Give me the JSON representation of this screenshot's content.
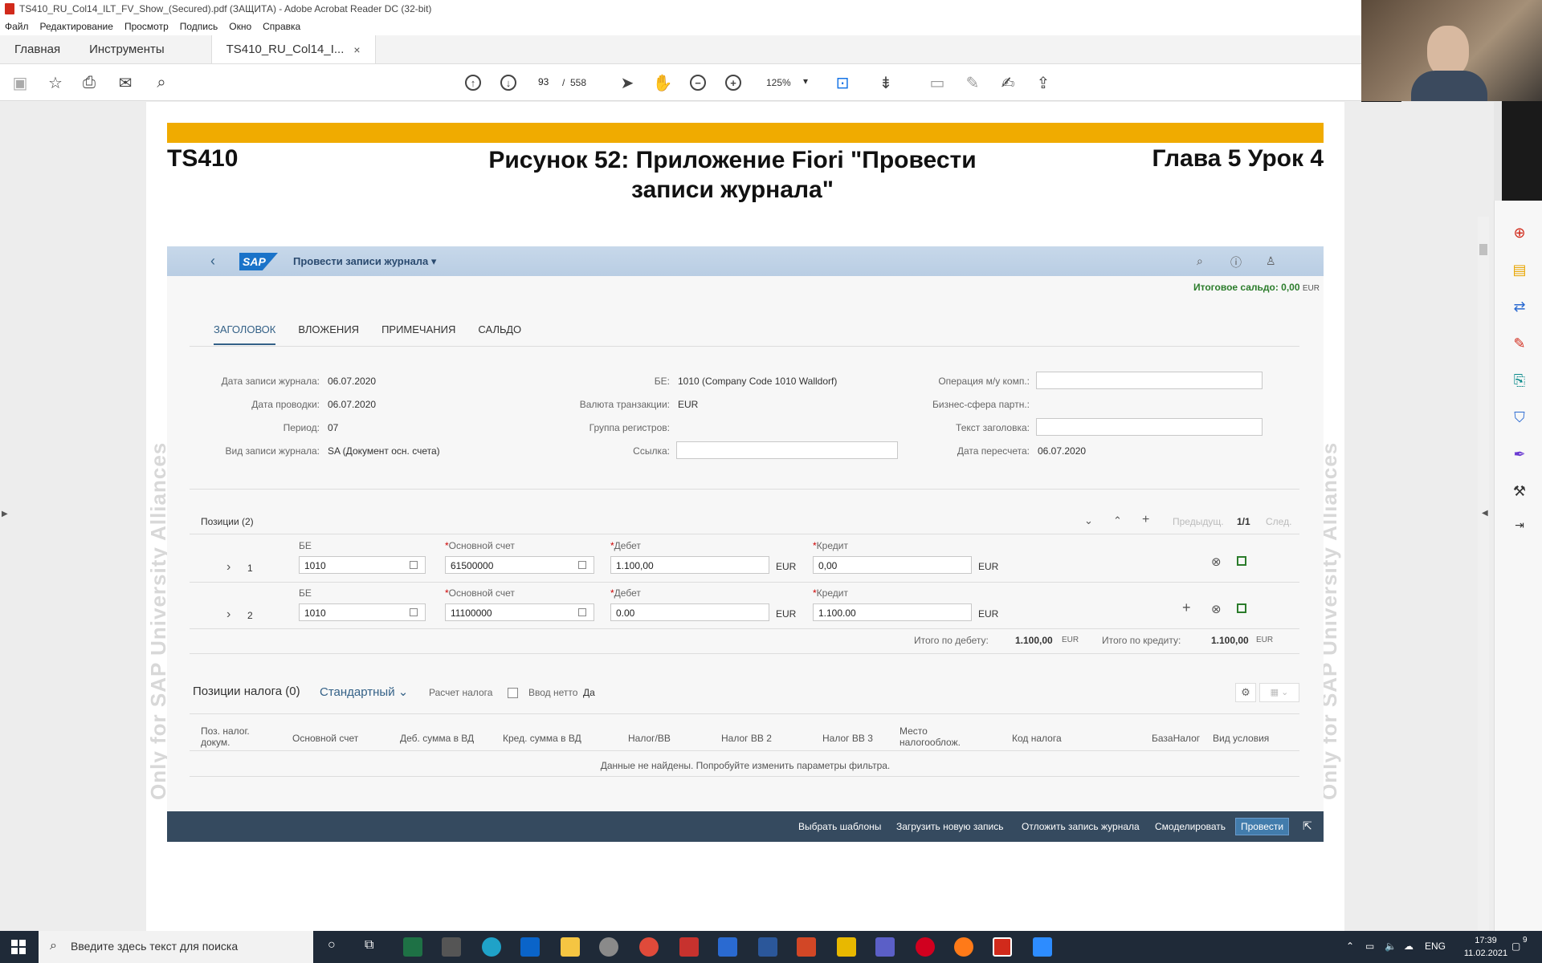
{
  "window": {
    "title": "TS410_RU_Col14_ILT_FV_Show_(Secured).pdf (ЗАЩИТА) - Adobe Acrobat Reader DC (32-bit)"
  },
  "menu": [
    "Файл",
    "Редактирование",
    "Просмотр",
    "Подпись",
    "Окно",
    "Справка"
  ],
  "tabs": {
    "home": "Главная",
    "tools": "Инструменты",
    "doc": "TS410_RU_Col14_I...",
    "close": "×"
  },
  "toolbar": {
    "page_current": "93",
    "page_sep": "/",
    "page_total": "558",
    "zoom": "125%"
  },
  "page": {
    "left_header": "TS410",
    "center_header": "Рисунок 52: Приложение Fiori \"Провести записи журнала\"",
    "right_header": "Глава 5 Урок 4",
    "watermark": "Only for SAP University Alliances"
  },
  "fiori": {
    "logo": "SAP",
    "app_title": "Провести записи журнала ▾",
    "balance_label": "Итоговое сальдо: 0,00",
    "balance_currency": "EUR",
    "tabs": [
      "ЗАГОЛОВОК",
      "ВЛОЖЕНИЯ",
      "ПРИМЕЧАНИЯ",
      "САЛЬДО"
    ],
    "header": {
      "doc_date_label": "Дата записи журнала:",
      "doc_date": "06.07.2020",
      "post_date_label": "Дата проводки:",
      "post_date": "06.07.2020",
      "period_label": "Период:",
      "period": "07",
      "type_label": "Вид записи журнала:",
      "type": "SA (Документ осн. счета)",
      "cc_label": "БЕ:",
      "cc": "1010 (Company Code 1010 Walldorf)",
      "currency_label": "Валюта транзакции:",
      "currency": "EUR",
      "ledger_label": "Группа регистров:",
      "ref_label": "Ссылка:",
      "interco_label": "Операция м/у комп.:",
      "partner_label": "Бизнес-сфера партн.:",
      "header_text_label": "Текст заголовка:",
      "translation_label": "Дата пересчета:",
      "translation_date": "06.07.2020"
    },
    "items_title": "Позиции (2)",
    "pager_prev": "Предыдущ.",
    "pager": "1/1",
    "pager_next": "След.",
    "col_cc": "БЕ",
    "col_gl": "Основной счет",
    "col_debit": "Дебет",
    "col_credit": "Кредит",
    "rows": [
      {
        "num": "1",
        "cc": "1010",
        "gl": "61500000",
        "debit": "1.100,00",
        "debit_cur": "EUR",
        "credit": "0,00",
        "credit_cur": "EUR"
      },
      {
        "num": "2",
        "cc": "1010",
        "gl": "11100000",
        "debit": "0.00",
        "debit_cur": "EUR",
        "credit": "1.100.00",
        "credit_cur": "EUR"
      }
    ],
    "total_debit_label": "Итого по дебету:",
    "total_debit": "1.100,00",
    "total_debit_cur": "EUR",
    "total_credit_label": "Итого по кредиту:",
    "total_credit": "1.100,00",
    "total_credit_cur": "EUR",
    "tax": {
      "title": "Позиции налога (0)",
      "variant": "Стандартный",
      "calc_label": "Расчет налога",
      "net_label": "Ввод нетто",
      "net_value": "Да",
      "cols": [
        "Поз. налог. докум.",
        "Основной счет",
        "Деб. сумма в ВД",
        "Кред. сумма в ВД",
        "Налог/ВВ",
        "Налог ВВ 2",
        "Налог ВВ 3",
        "Место налогооблож.",
        "Код налога",
        "БазаНалог",
        "Вид условия"
      ],
      "empty": "Данные не найдены. Попробуйте изменить параметры фильтра."
    },
    "footer": {
      "templates": "Выбрать шаблоны",
      "upload": "Загрузить новую запись",
      "park": "Отложить запись журнала",
      "simulate": "Смоделировать",
      "post": "Провести"
    }
  },
  "taskbar": {
    "search_placeholder": "Введите здесь текст для поиска",
    "lang": "ENG",
    "time": "17:39",
    "date": "11.02.2021",
    "notif_count": "9"
  }
}
